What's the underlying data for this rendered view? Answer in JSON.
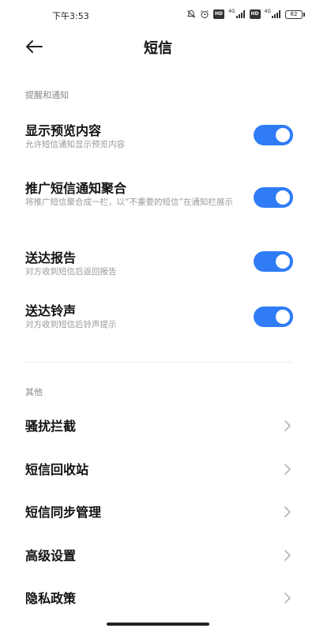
{
  "status_bar": {
    "time": "下午3:53",
    "hd1": "HD",
    "hd2": "HD",
    "sig1": "4G",
    "sig2": "4G",
    "battery": "62"
  },
  "header": {
    "back_icon": "back-arrow-icon",
    "title": "短信"
  },
  "notifications_section": {
    "header": "提醒和通知",
    "items": [
      {
        "title": "显示预览内容",
        "desc": "允许短信通知显示预览内容",
        "enabled": true
      },
      {
        "title": "推广短信通知聚合",
        "desc": "将推广短信聚合成一栏，以“不重要的短信”在通知栏展示",
        "enabled": true
      },
      {
        "title": "送达报告",
        "desc": "对方收到短信后返回报告",
        "enabled": true
      },
      {
        "title": "送达铃声",
        "desc": "对方收到短信后铃声提示",
        "enabled": true
      }
    ]
  },
  "other_section": {
    "header": "其他",
    "items": [
      {
        "label": "骚扰拦截"
      },
      {
        "label": "短信回收站"
      },
      {
        "label": "短信同步管理"
      },
      {
        "label": "高级设置"
      },
      {
        "label": "隐私政策"
      }
    ]
  },
  "colors": {
    "accent": "#2f7cf6",
    "section_header": "#888888",
    "description": "#9a9a9a"
  }
}
